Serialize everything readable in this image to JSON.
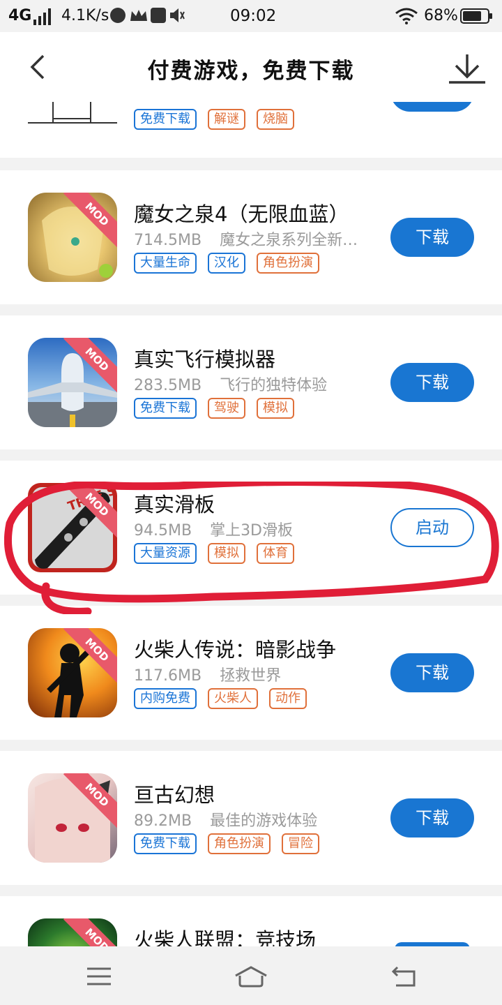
{
  "status_bar": {
    "network": "4G",
    "speed": "4.1K/s",
    "time": "09:02",
    "battery": "68%"
  },
  "header": {
    "title": "付费游戏，免费下载"
  },
  "partial_top": {
    "tags": [
      {
        "label": "免费下载",
        "color": "blue"
      },
      {
        "label": "解谜",
        "color": "orange"
      },
      {
        "label": "烧脑",
        "color": "orange"
      }
    ]
  },
  "apps": [
    {
      "name": "魔女之泉4（无限血蓝）",
      "size": "714.5MB",
      "desc": "魔女之泉系列全新…",
      "tags": [
        "大量生命",
        "汉化",
        "角色扮演"
      ],
      "button": "下载",
      "ribbon": "MOD"
    },
    {
      "name": "真实飞行模拟器",
      "size": "283.5MB",
      "desc": "飞行的独特体验",
      "tags": [
        "免费下载",
        "驾驶",
        "模拟"
      ],
      "button": "下载",
      "ribbon": "MOD"
    },
    {
      "name": "真实滑板",
      "size": "94.5MB",
      "desc": "掌上3D滑板",
      "tags": [
        "大量资源",
        "模拟",
        "体育"
      ],
      "button": "启动",
      "ribbon": "MOD",
      "icon_text": "TRUE SKATE"
    },
    {
      "name": "火柴人传说：暗影战争",
      "size": "117.6MB",
      "desc": "拯救世界",
      "tags": [
        "内购免费",
        "火柴人",
        "动作"
      ],
      "button": "下载",
      "ribbon": "MOD"
    },
    {
      "name": "亘古幻想",
      "size": "89.2MB",
      "desc": "最佳的游戏体验",
      "tags": [
        "免费下载",
        "角色扮演",
        "冒险"
      ],
      "button": "下载",
      "ribbon": "MOD"
    },
    {
      "name": "火柴人联盟：竞技场",
      "ribbon": "MOD"
    }
  ],
  "colors": {
    "accent": "#1976d2",
    "tag_blue": "#1a74d6",
    "tag_orange": "#e0703a",
    "annotation": "#e01e37"
  }
}
